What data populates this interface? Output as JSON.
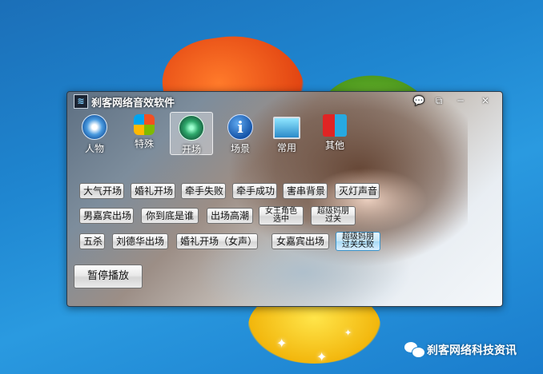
{
  "window": {
    "title": "刹客网络音效软件",
    "controls": {
      "chat": "💬",
      "restore": "⧉",
      "minimize": "─",
      "close": "✕"
    }
  },
  "nav": [
    {
      "label": "人物",
      "icon": "compass-icon"
    },
    {
      "label": "特殊",
      "icon": "windows-icon"
    },
    {
      "label": "开场",
      "icon": "radar-icon",
      "active": true
    },
    {
      "label": "场景",
      "icon": "info-icon",
      "glyph": "i"
    },
    {
      "label": "常用",
      "icon": "monitor-icon"
    },
    {
      "label": "其他",
      "icon": "cubes-icon"
    }
  ],
  "buttons": {
    "row1": [
      "大气开场",
      "婚礼开场",
      "牵手失败",
      "牵手成功",
      "害串背景",
      "灭灯声音"
    ],
    "row2": [
      "男嘉宾出场",
      "你到底是谁",
      "出场高潮",
      "女王角色选中",
      "超级妈朋过关"
    ],
    "row3": [
      "五杀",
      "刘德华出场",
      "婚礼开场（女声）",
      "女嘉宾出场",
      "超级妈朋过关失败"
    ],
    "pause": "暂停播放"
  },
  "footer": {
    "text": "刹客网络科技资讯",
    "icon": "wechat-icon"
  }
}
